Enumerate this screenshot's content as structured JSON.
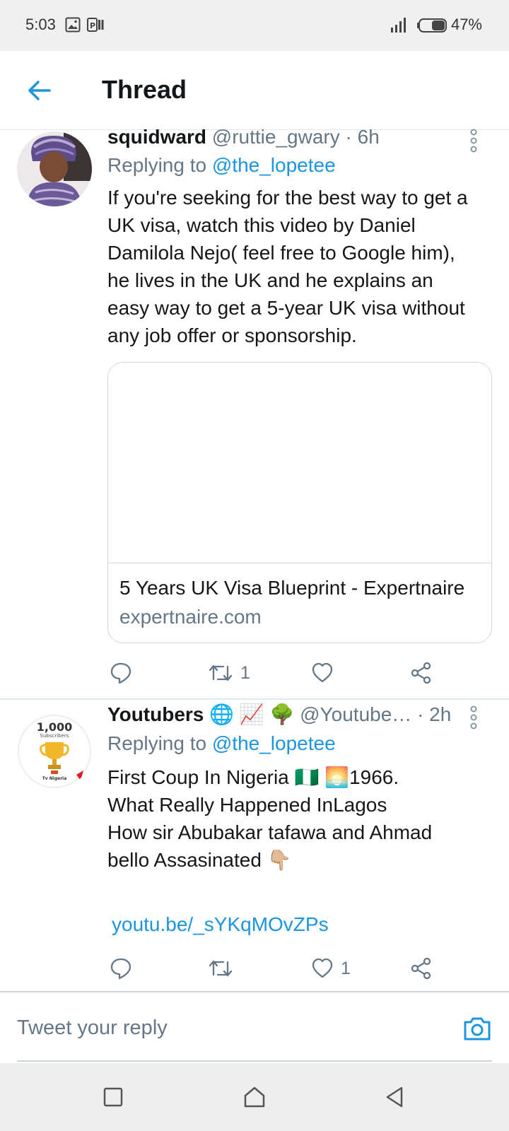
{
  "status_bar": {
    "time": "5:03",
    "battery": "47%",
    "icons": [
      "gallery-icon",
      "notes-icon",
      "signal-icon",
      "battery-icon"
    ]
  },
  "header": {
    "title": "Thread",
    "back_icon": "arrow-left-icon"
  },
  "tweets": [
    {
      "name": "squidward",
      "handle": "@ruttie_gwary",
      "time": "· 6h",
      "replying_prefix": "Replying to ",
      "replying_to": "@the_lopetee",
      "text_lines": [
        "If you're seeking for the best way to get a",
        "UK visa, watch this video by Daniel",
        "Damilola Nejo( feel free to Google him),",
        "he lives in the UK and he explains an",
        "easy way to get a 5-year UK visa without",
        "any job offer or sponsorship."
      ],
      "card": {
        "title": "5 Years UK Visa Blueprint - Expertnaire",
        "domain": "expertnaire.com"
      },
      "retweets": "1",
      "likes": ""
    },
    {
      "name": "Youtubers",
      "name_emoji": "🌐 📈 🌳",
      "handle": "@Youtube…",
      "time": "· 2h",
      "replying_prefix": "Replying to ",
      "replying_to": "@the_lopetee",
      "avatar_text": "1,000",
      "avatar_sub": "Subscribers",
      "avatar_caption": "Tv Nigeria",
      "text_lines": [
        "First Coup In Nigeria 🇳🇬 🌅1966.",
        "What Really Happened InLagos",
        "How sir Abubakar tafawa and Ahmad",
        "bello Assasinated 👇🏼"
      ],
      "link": "youtu.be/_sYKqMOvZPs",
      "retweets": "",
      "likes": "1"
    }
  ],
  "reply_bar": {
    "placeholder": "Tweet your reply",
    "camera_icon": "camera-icon"
  },
  "colors": {
    "accent": "#1b95e0",
    "secondary_text": "#657786",
    "border": "#e1e8ed"
  }
}
